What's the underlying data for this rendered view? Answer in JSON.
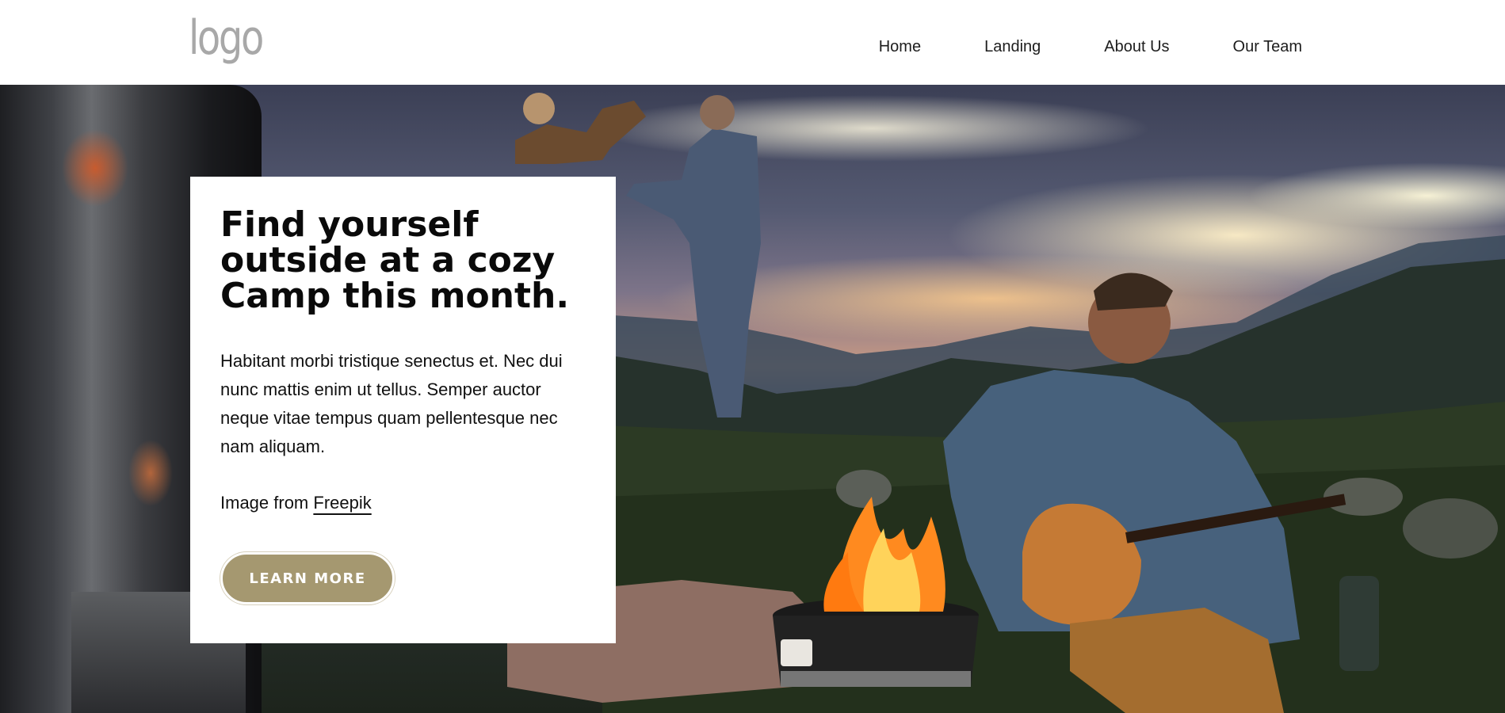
{
  "header": {
    "logo_text": "logo",
    "nav": [
      {
        "label": "Home"
      },
      {
        "label": "Landing"
      },
      {
        "label": "About Us"
      },
      {
        "label": "Our Team"
      }
    ]
  },
  "hero": {
    "headline": "Find yourself outside at a cozy Camp this month.",
    "body": "Habitant morbi tristique senectus et. Nec dui nunc mattis enim ut tellus. Semper auctor neque vitae tempus quam pellentesque nec nam aliquam.",
    "credit_prefix": "Image from ",
    "credit_link": "Freepik",
    "cta_label": "LEARN MORE"
  },
  "colors": {
    "accent": "#a59870",
    "text": "#111111",
    "header_bg": "#ffffff",
    "logo": "#a8a8a8"
  },
  "icons": [
    "logo-image",
    "hero-background-image"
  ]
}
